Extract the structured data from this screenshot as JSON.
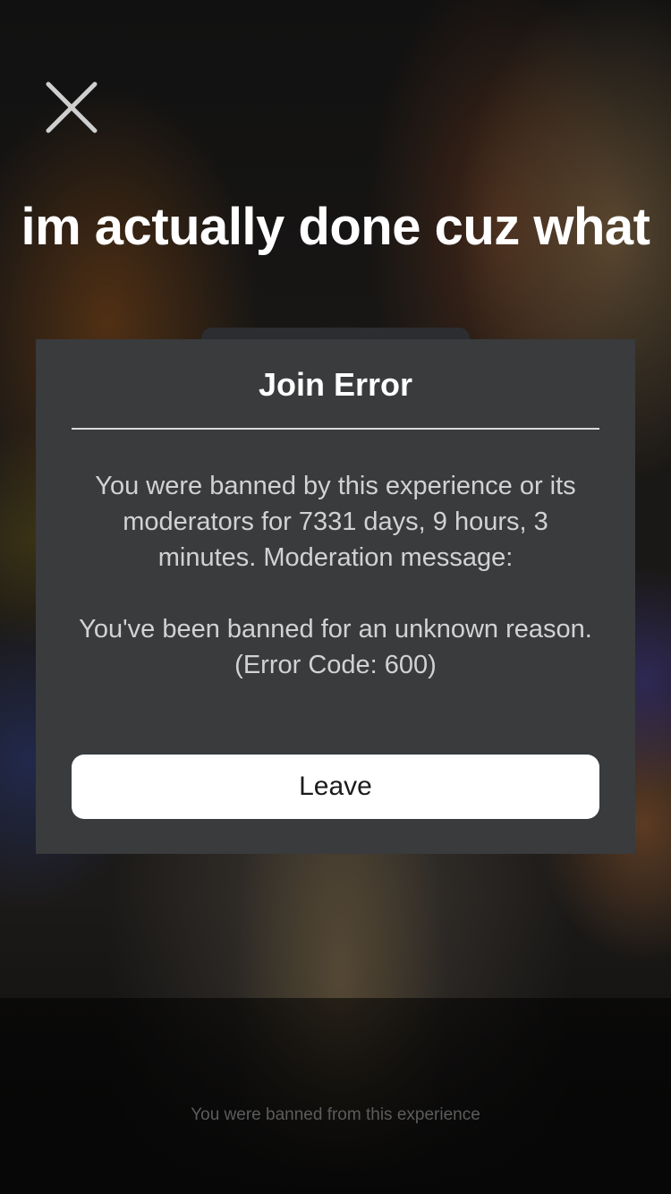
{
  "post": {
    "caption": "im actually done cuz what"
  },
  "dialog": {
    "title": "Join Error",
    "message": "You were banned by this experience or its moderators for 7331 days, 9 hours, 3 minutes. Moderation message:",
    "reason_line": "You've been banned for an unknown reason.",
    "error_code": "(Error Code: 600)",
    "leave_label": "Leave"
  },
  "footer": {
    "status_text": "You were banned from this experience"
  },
  "icons": {
    "close": "close-icon"
  },
  "colors": {
    "dialog_bg": "#393b3d",
    "button_bg": "#ffffff",
    "caption_text": "#ffffff"
  }
}
